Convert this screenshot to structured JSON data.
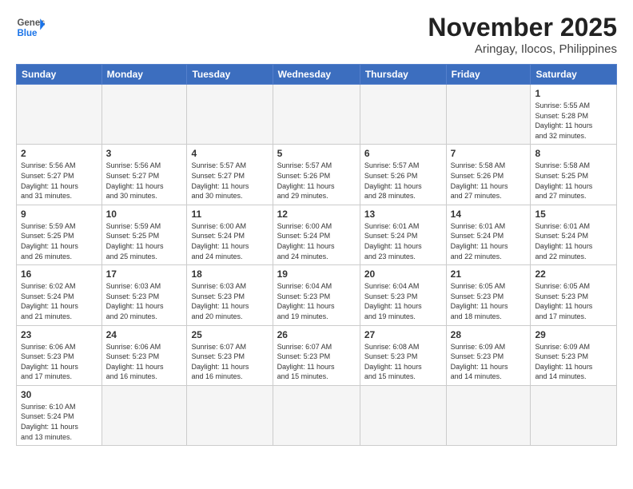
{
  "header": {
    "logo_general": "General",
    "logo_blue": "Blue",
    "month_title": "November 2025",
    "location": "Aringay, Ilocos, Philippines"
  },
  "weekdays": [
    "Sunday",
    "Monday",
    "Tuesday",
    "Wednesday",
    "Thursday",
    "Friday",
    "Saturday"
  ],
  "days": [
    {
      "num": "",
      "info": ""
    },
    {
      "num": "",
      "info": ""
    },
    {
      "num": "",
      "info": ""
    },
    {
      "num": "",
      "info": ""
    },
    {
      "num": "",
      "info": ""
    },
    {
      "num": "",
      "info": ""
    },
    {
      "num": "1",
      "info": "Sunrise: 5:55 AM\nSunset: 5:28 PM\nDaylight: 11 hours\nand 32 minutes."
    },
    {
      "num": "2",
      "info": "Sunrise: 5:56 AM\nSunset: 5:27 PM\nDaylight: 11 hours\nand 31 minutes."
    },
    {
      "num": "3",
      "info": "Sunrise: 5:56 AM\nSunset: 5:27 PM\nDaylight: 11 hours\nand 30 minutes."
    },
    {
      "num": "4",
      "info": "Sunrise: 5:57 AM\nSunset: 5:27 PM\nDaylight: 11 hours\nand 30 minutes."
    },
    {
      "num": "5",
      "info": "Sunrise: 5:57 AM\nSunset: 5:26 PM\nDaylight: 11 hours\nand 29 minutes."
    },
    {
      "num": "6",
      "info": "Sunrise: 5:57 AM\nSunset: 5:26 PM\nDaylight: 11 hours\nand 28 minutes."
    },
    {
      "num": "7",
      "info": "Sunrise: 5:58 AM\nSunset: 5:26 PM\nDaylight: 11 hours\nand 27 minutes."
    },
    {
      "num": "8",
      "info": "Sunrise: 5:58 AM\nSunset: 5:25 PM\nDaylight: 11 hours\nand 27 minutes."
    },
    {
      "num": "9",
      "info": "Sunrise: 5:59 AM\nSunset: 5:25 PM\nDaylight: 11 hours\nand 26 minutes."
    },
    {
      "num": "10",
      "info": "Sunrise: 5:59 AM\nSunset: 5:25 PM\nDaylight: 11 hours\nand 25 minutes."
    },
    {
      "num": "11",
      "info": "Sunrise: 6:00 AM\nSunset: 5:24 PM\nDaylight: 11 hours\nand 24 minutes."
    },
    {
      "num": "12",
      "info": "Sunrise: 6:00 AM\nSunset: 5:24 PM\nDaylight: 11 hours\nand 24 minutes."
    },
    {
      "num": "13",
      "info": "Sunrise: 6:01 AM\nSunset: 5:24 PM\nDaylight: 11 hours\nand 23 minutes."
    },
    {
      "num": "14",
      "info": "Sunrise: 6:01 AM\nSunset: 5:24 PM\nDaylight: 11 hours\nand 22 minutes."
    },
    {
      "num": "15",
      "info": "Sunrise: 6:01 AM\nSunset: 5:24 PM\nDaylight: 11 hours\nand 22 minutes."
    },
    {
      "num": "16",
      "info": "Sunrise: 6:02 AM\nSunset: 5:24 PM\nDaylight: 11 hours\nand 21 minutes."
    },
    {
      "num": "17",
      "info": "Sunrise: 6:03 AM\nSunset: 5:23 PM\nDaylight: 11 hours\nand 20 minutes."
    },
    {
      "num": "18",
      "info": "Sunrise: 6:03 AM\nSunset: 5:23 PM\nDaylight: 11 hours\nand 20 minutes."
    },
    {
      "num": "19",
      "info": "Sunrise: 6:04 AM\nSunset: 5:23 PM\nDaylight: 11 hours\nand 19 minutes."
    },
    {
      "num": "20",
      "info": "Sunrise: 6:04 AM\nSunset: 5:23 PM\nDaylight: 11 hours\nand 19 minutes."
    },
    {
      "num": "21",
      "info": "Sunrise: 6:05 AM\nSunset: 5:23 PM\nDaylight: 11 hours\nand 18 minutes."
    },
    {
      "num": "22",
      "info": "Sunrise: 6:05 AM\nSunset: 5:23 PM\nDaylight: 11 hours\nand 17 minutes."
    },
    {
      "num": "23",
      "info": "Sunrise: 6:06 AM\nSunset: 5:23 PM\nDaylight: 11 hours\nand 17 minutes."
    },
    {
      "num": "24",
      "info": "Sunrise: 6:06 AM\nSunset: 5:23 PM\nDaylight: 11 hours\nand 16 minutes."
    },
    {
      "num": "25",
      "info": "Sunrise: 6:07 AM\nSunset: 5:23 PM\nDaylight: 11 hours\nand 16 minutes."
    },
    {
      "num": "26",
      "info": "Sunrise: 6:07 AM\nSunset: 5:23 PM\nDaylight: 11 hours\nand 15 minutes."
    },
    {
      "num": "27",
      "info": "Sunrise: 6:08 AM\nSunset: 5:23 PM\nDaylight: 11 hours\nand 15 minutes."
    },
    {
      "num": "28",
      "info": "Sunrise: 6:09 AM\nSunset: 5:23 PM\nDaylight: 11 hours\nand 14 minutes."
    },
    {
      "num": "29",
      "info": "Sunrise: 6:09 AM\nSunset: 5:23 PM\nDaylight: 11 hours\nand 14 minutes."
    },
    {
      "num": "30",
      "info": "Sunrise: 6:10 AM\nSunset: 5:24 PM\nDaylight: 11 hours\nand 13 minutes."
    },
    {
      "num": "",
      "info": ""
    },
    {
      "num": "",
      "info": ""
    },
    {
      "num": "",
      "info": ""
    },
    {
      "num": "",
      "info": ""
    },
    {
      "num": "",
      "info": ""
    }
  ]
}
